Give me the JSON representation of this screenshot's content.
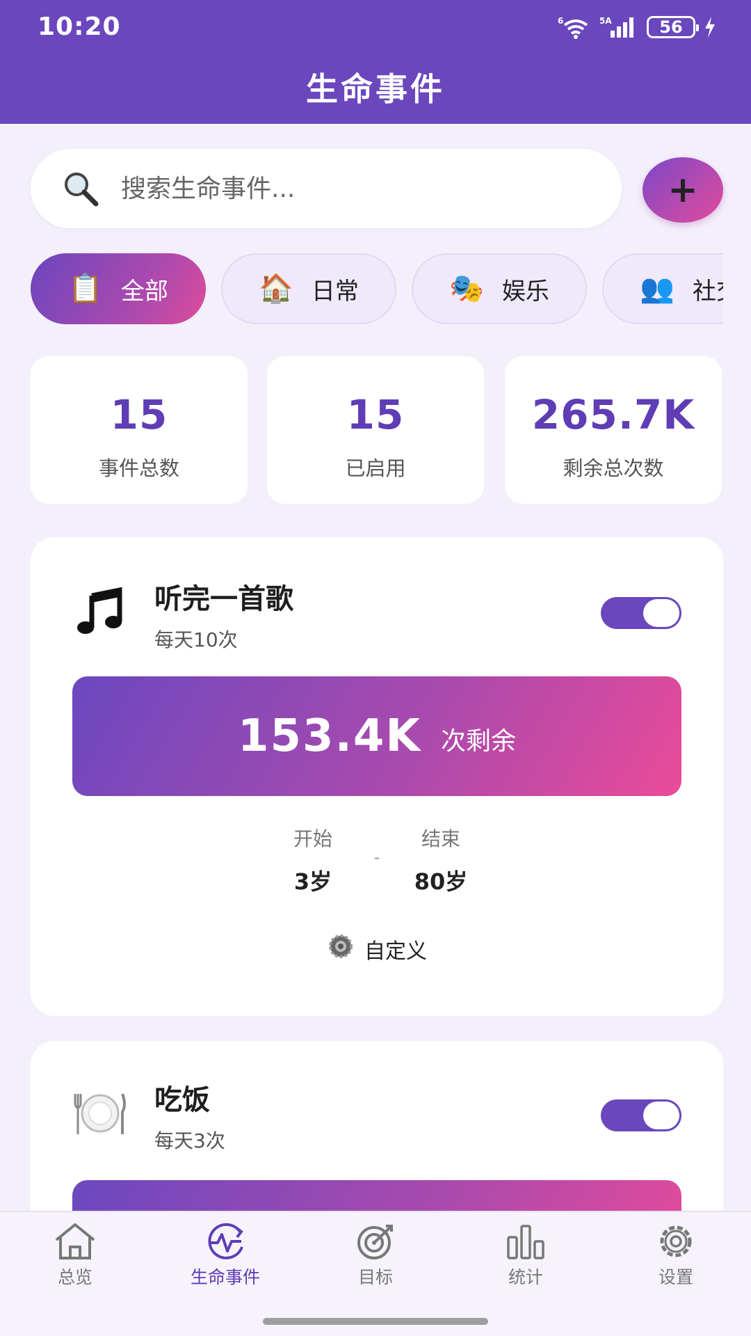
{
  "status_bar": {
    "time": "10:20",
    "wifi_label": "6",
    "signal_label": "5A",
    "battery": "56"
  },
  "header": {
    "title": "生命事件"
  },
  "search": {
    "placeholder": "搜索生命事件..."
  },
  "add_button": {
    "label": "+"
  },
  "chips": [
    {
      "label": "全部",
      "icon": "clipboard-icon",
      "glyph": "📋",
      "active": true
    },
    {
      "label": "日常",
      "icon": "house-icon",
      "glyph": "🏠",
      "active": false
    },
    {
      "label": "娱乐",
      "icon": "theater-masks-icon",
      "glyph": "🎭",
      "active": false
    },
    {
      "label": "社交",
      "icon": "people-icon",
      "glyph": "👥",
      "active": false
    }
  ],
  "stats": [
    {
      "value": "15",
      "label": "事件总数"
    },
    {
      "value": "15",
      "label": "已启用"
    },
    {
      "value": "265.7K",
      "label": "剩余总次数"
    }
  ],
  "events": [
    {
      "title": "听完一首歌",
      "frequency": "每天10次",
      "icon": "music-note-icon",
      "enabled": true,
      "remaining_value": "153.4K",
      "remaining_suffix": "次剩余",
      "start_label": "开始",
      "start_value": "3岁",
      "end_label": "结束",
      "end_value": "80岁",
      "separator": "-",
      "mode_label": "自定义",
      "mode_icon": "gear-icon"
    },
    {
      "title": "吃饭",
      "frequency": "每天3次",
      "icon": "plate-icon",
      "enabled": true
    }
  ],
  "nav": [
    {
      "label": "总览",
      "icon": "home-icon",
      "active": false
    },
    {
      "label": "生命事件",
      "icon": "pulse-cycle-icon",
      "active": true
    },
    {
      "label": "目标",
      "icon": "target-icon",
      "active": false
    },
    {
      "label": "统计",
      "icon": "bar-chart-icon",
      "active": false
    },
    {
      "label": "设置",
      "icon": "gear-icon",
      "active": false
    }
  ],
  "colors": {
    "primary": "#6a47bd",
    "accent_gradient_start": "#6c48bf",
    "accent_gradient_end": "#ea4b98",
    "background": "#f4f0fb"
  }
}
